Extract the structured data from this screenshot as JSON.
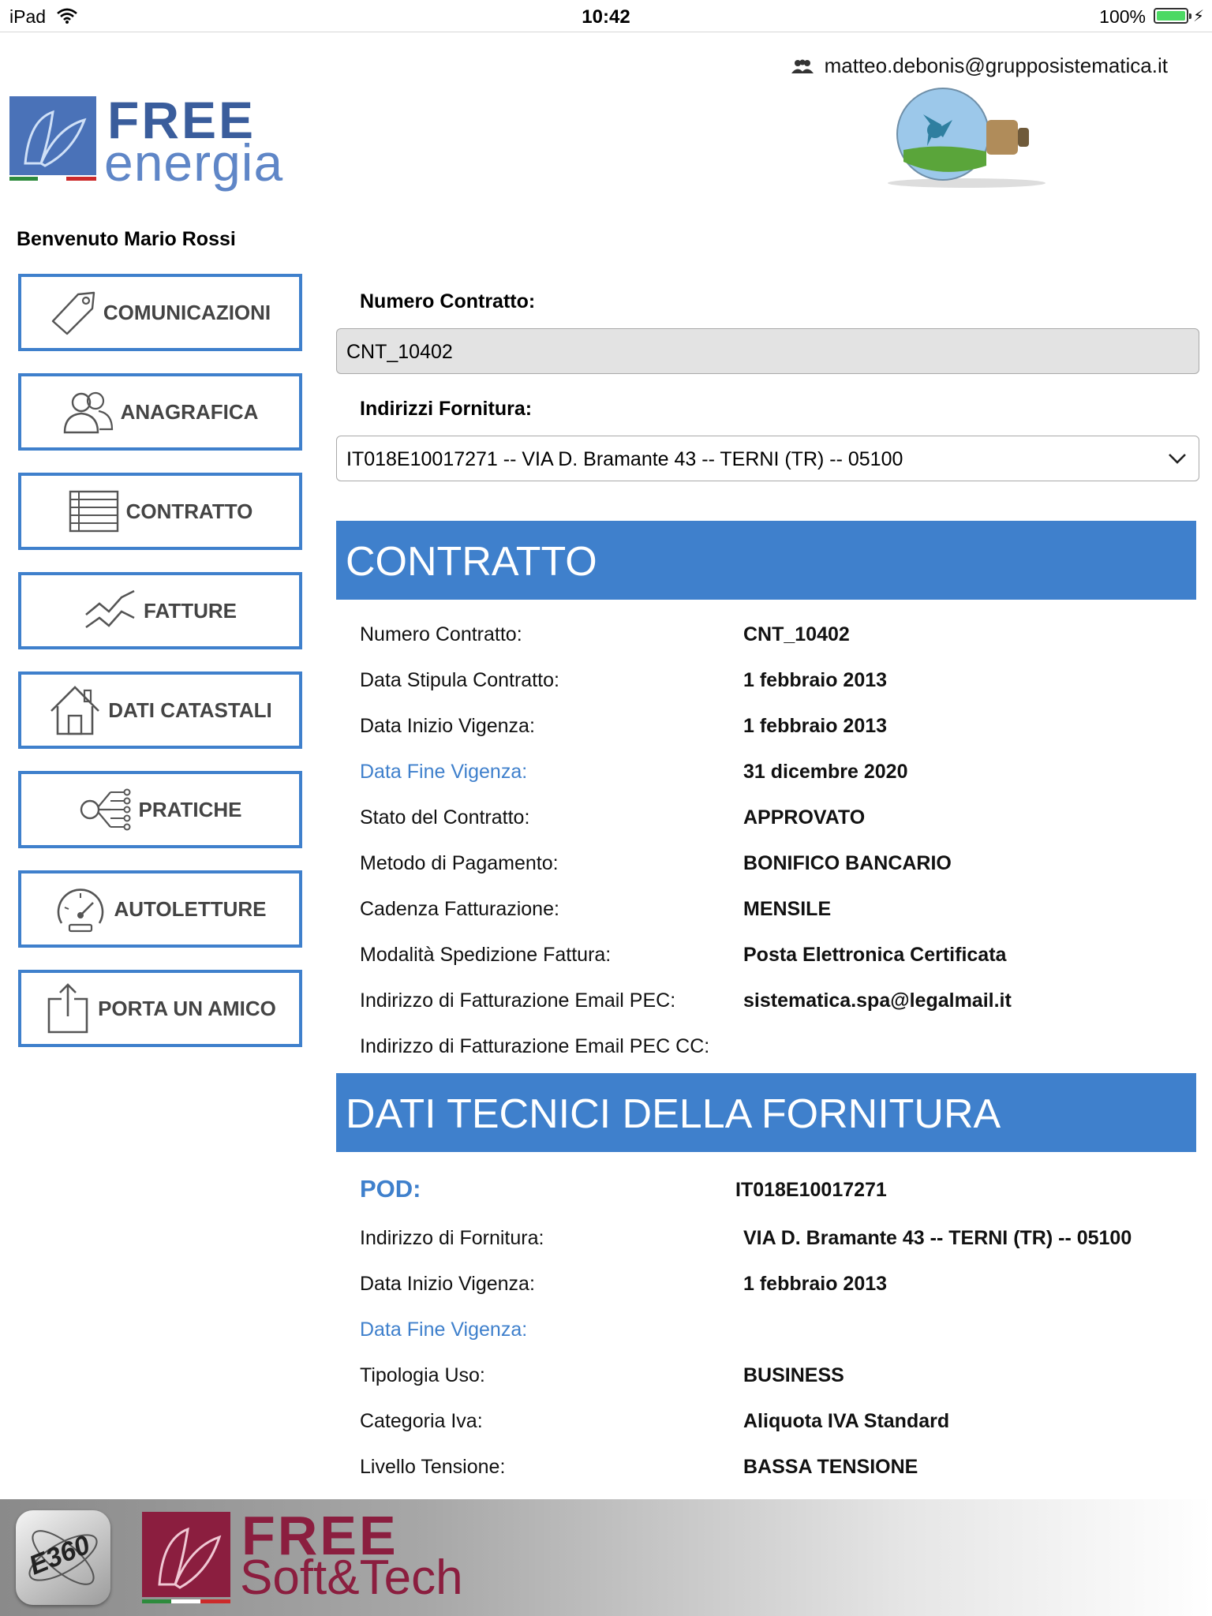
{
  "status_bar": {
    "device": "iPad",
    "time": "10:42",
    "battery": "100%"
  },
  "header": {
    "user_email": "matteo.debonis@grupposistematica.it",
    "logo_word1": "FREE",
    "logo_word2": "energia",
    "welcome": "Benvenuto Mario Rossi"
  },
  "sidebar": {
    "items": [
      {
        "label": "COMUNICAZIONI",
        "icon": "tag-icon"
      },
      {
        "label": "ANAGRAFICA",
        "icon": "users-icon"
      },
      {
        "label": "CONTRATTO",
        "icon": "list-icon"
      },
      {
        "label": "FATTURE",
        "icon": "chart-line-icon"
      },
      {
        "label": "DATI CATASTALI",
        "icon": "house-icon"
      },
      {
        "label": "PRATICHE",
        "icon": "flow-icon"
      },
      {
        "label": "AUTOLETTURE",
        "icon": "gauge-icon"
      },
      {
        "label": "PORTA UN AMICO",
        "icon": "share-icon"
      }
    ]
  },
  "form": {
    "contract_label": "Numero Contratto:",
    "contract_value": "CNT_10402",
    "supply_label": "Indirizzi Fornitura:",
    "supply_value": "IT018E10017271 -- VIA D. Bramante 43 -- TERNI (TR) -- 05100"
  },
  "contratto": {
    "title": "CONTRATTO",
    "rows": [
      {
        "label": "Numero Contratto:",
        "value": "CNT_10402"
      },
      {
        "label": "Data Stipula Contratto:",
        "value": "1 febbraio 2013"
      },
      {
        "label": "Data Inizio Vigenza:",
        "value": "1 febbraio 2013"
      },
      {
        "label": "Data Fine Vigenza:",
        "value": "31 dicembre 2020"
      },
      {
        "label": "Stato del Contratto:",
        "value": "APPROVATO"
      },
      {
        "label": "Metodo di Pagamento:",
        "value": "BONIFICO BANCARIO"
      },
      {
        "label": "Cadenza Fatturazione:",
        "value": "MENSILE"
      },
      {
        "label": "Modalità Spedizione Fattura:",
        "value": "Posta Elettronica Certificata"
      },
      {
        "label": "Indirizzo di Fatturazione Email PEC:",
        "value": "sistematica.spa@legalmail.it"
      },
      {
        "label": "Indirizzo di Fatturazione Email PEC CC:",
        "value": ""
      }
    ]
  },
  "dati_tecnici": {
    "title": "DATI TECNICI DELLA FORNITURA",
    "pod_label": "POD:",
    "pod_value": "IT018E10017271",
    "rows": [
      {
        "label": "Indirizzo di Fornitura:",
        "value": "VIA D. Bramante 43 -- TERNI (TR) -- 05100"
      },
      {
        "label": "Data Inizio Vigenza:",
        "value": "1 febbraio 2013"
      },
      {
        "label": "Data Fine Vigenza:",
        "value": ""
      },
      {
        "label": "Tipologia Uso:",
        "value": "BUSINESS"
      },
      {
        "label": "Categoria Iva:",
        "value": "Aliquota IVA Standard"
      },
      {
        "label": "Livello Tensione:",
        "value": "BASSA TENSIONE"
      }
    ]
  },
  "footer": {
    "app_badge": "E360",
    "logo_word1": "FREE",
    "logo_word2": "Soft&Tech"
  },
  "colors": {
    "accent": "#3f80cc",
    "footer_brand": "#8b1e3f"
  }
}
